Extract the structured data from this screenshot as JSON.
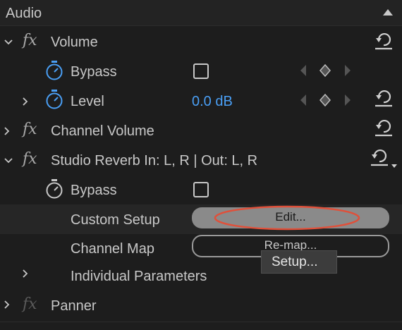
{
  "header": {
    "title": "Audio"
  },
  "volume": {
    "label": "Volume",
    "fx": "fx",
    "bypass": {
      "label": "Bypass",
      "checked": false
    },
    "level": {
      "label": "Level",
      "value": "0.0 dB"
    }
  },
  "channel_volume": {
    "label": "Channel Volume",
    "fx": "fx"
  },
  "studio_reverb": {
    "label": "Studio Reverb In: L, R | Out: L, R",
    "fx": "fx",
    "bypass": {
      "label": "Bypass",
      "checked": false
    },
    "custom_setup": {
      "label": "Custom Setup",
      "button": "Edit..."
    },
    "channel_map": {
      "label": "Channel Map",
      "button": "Re-map..."
    },
    "individual_parameters": {
      "label": "Individual Parameters"
    }
  },
  "tooltip": {
    "text": "Setup..."
  },
  "panner": {
    "label": "Panner",
    "fx": "fx"
  },
  "colors": {
    "accent": "#4a9ff5",
    "highlight_ring": "#e0503a",
    "button_fill": "#8a8a8a"
  }
}
